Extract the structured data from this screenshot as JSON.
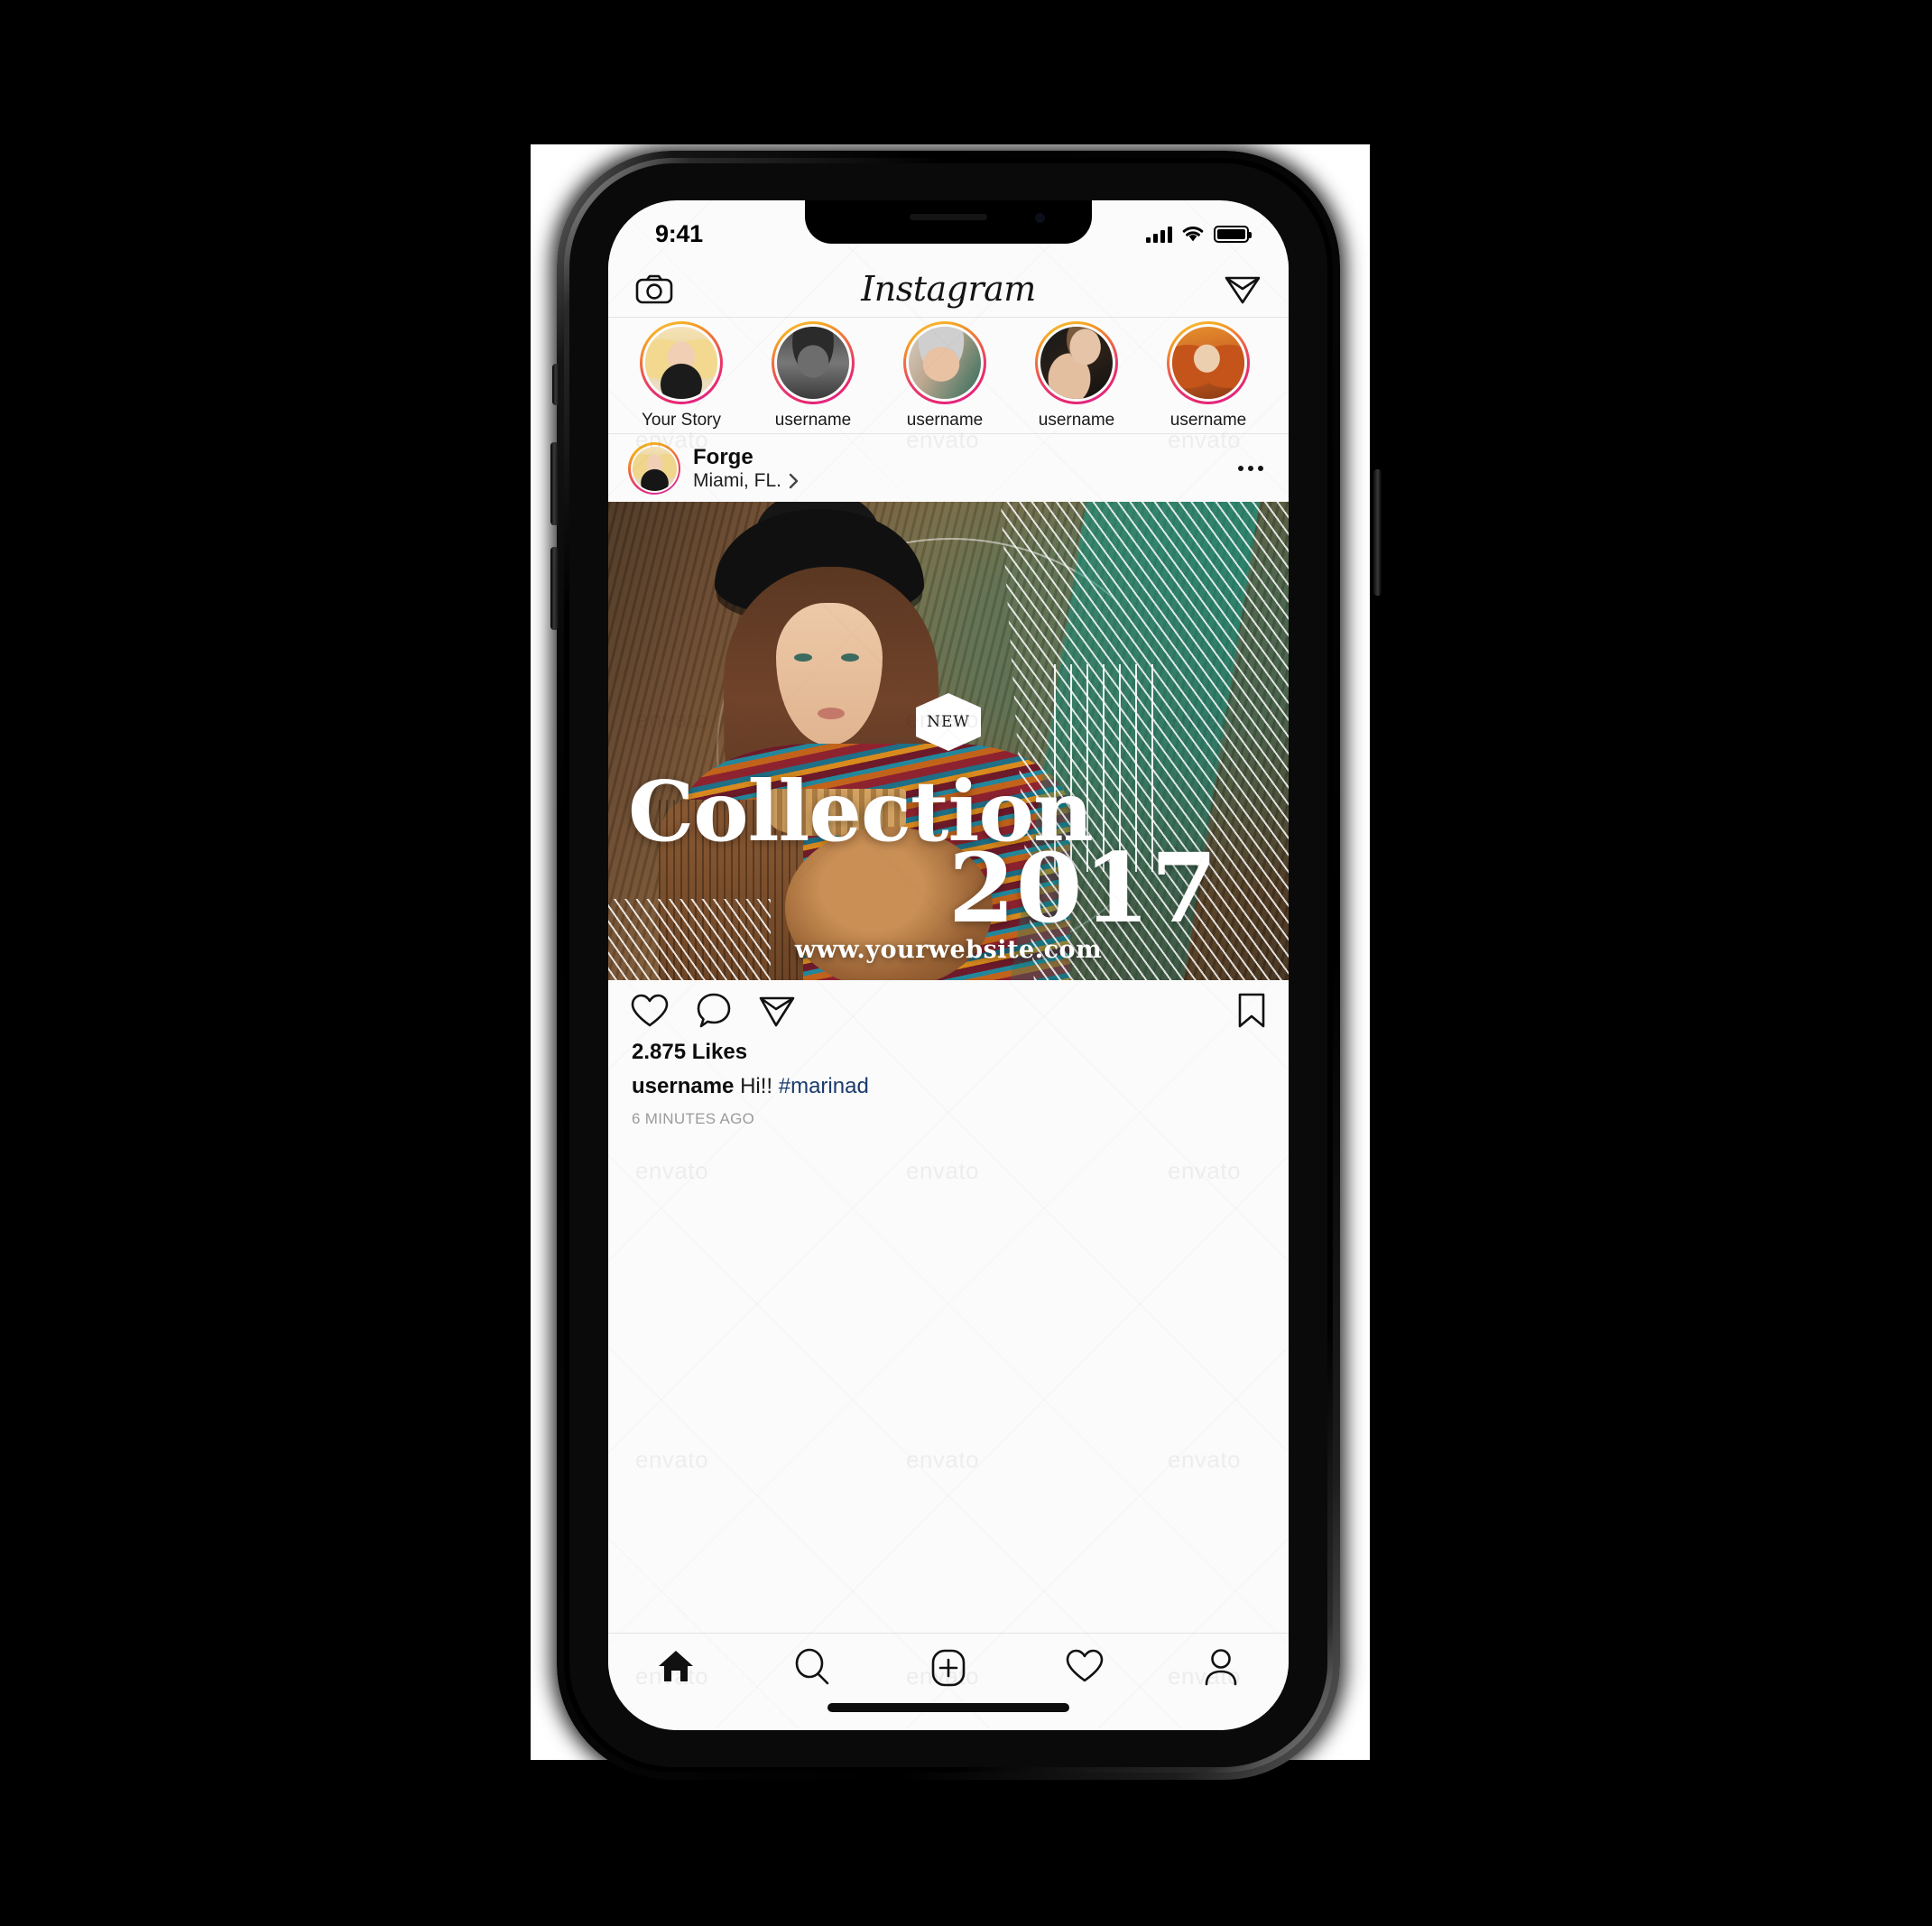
{
  "status_bar": {
    "time": "9:41",
    "signal_icon": "cellular-signal-icon",
    "wifi_icon": "wifi-icon",
    "battery_icon": "battery-full-icon"
  },
  "app_header": {
    "camera_icon": "camera-icon",
    "logo": "Instagram",
    "send_icon": "send-paper-plane-icon"
  },
  "stories": [
    {
      "label": "Your Story",
      "avatar": "p1"
    },
    {
      "label": "username",
      "avatar": "p2"
    },
    {
      "label": "username",
      "avatar": "p3"
    },
    {
      "label": "username",
      "avatar": "p4"
    },
    {
      "label": "username",
      "avatar": "p5"
    }
  ],
  "post": {
    "username": "Forge",
    "location": "Miami, FL.",
    "location_chevron": "chevron-right-icon",
    "more_menu": "more-options-icon",
    "image_overlay": {
      "badge": "NEW",
      "title_line1": "Collection",
      "title_line2": "2017",
      "website": "www.yourwebsite.com"
    },
    "actions": {
      "like_icon": "heart-outline-icon",
      "comment_icon": "comment-bubble-icon",
      "share_icon": "send-paper-plane-icon",
      "save_icon": "bookmark-outline-icon"
    },
    "likes": "2.875 Likes",
    "caption_user": "username",
    "caption_text": "Hi!!",
    "caption_hashtag": "#marinad",
    "timestamp": "6 MINUTES AGO"
  },
  "tab_bar": [
    {
      "name": "home",
      "icon": "home-filled-icon",
      "active": true
    },
    {
      "name": "search",
      "icon": "search-icon",
      "active": false
    },
    {
      "name": "add",
      "icon": "add-plus-box-icon",
      "active": false
    },
    {
      "name": "activity",
      "icon": "heart-outline-icon",
      "active": false
    },
    {
      "name": "profile",
      "icon": "person-outline-icon",
      "active": false
    }
  ],
  "colors": {
    "gradient_start": "#f9c941",
    "gradient_mid": "#f06f3b",
    "gradient_end": "#d6249f",
    "hashtag": "#1a3a6b",
    "screen_bg": "#fbfbfb",
    "text": "#0d0d0d"
  },
  "watermark": "envato"
}
